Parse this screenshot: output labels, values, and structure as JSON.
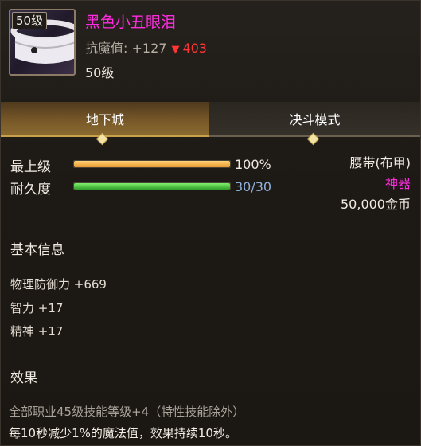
{
  "item": {
    "level_badge": "50级",
    "name": "黑色小丑眼泪",
    "stat_label": "抗魔值: +127",
    "stat_arrow": "▼",
    "stat_delta": "403",
    "required_level": "50级",
    "colors": {
      "name": "#ff2ce0",
      "decrease": "#ff3535"
    }
  },
  "tabs": [
    {
      "label": "地下城",
      "active": true
    },
    {
      "label": "决斗模式",
      "active": false
    }
  ],
  "bars": {
    "grade": {
      "label": "最上级",
      "value": "100%",
      "fill_fraction": 1.0,
      "color": "#e8992d"
    },
    "durability": {
      "label": "耐久度",
      "value": "30/30",
      "fill_fraction": 1.0,
      "color": "#2f9d2a",
      "value_color": "#8fb0d8"
    }
  },
  "info": {
    "type": "腰带(布甲)",
    "rarity": "神器",
    "rarity_color": "#ff2ce0",
    "price": "50,000金币"
  },
  "basic": {
    "title": "基本信息",
    "attributes": [
      "物理防御力 +669",
      "智力 +17",
      "精神 +17"
    ]
  },
  "effects": {
    "title": "效果",
    "lines": [
      "全部职业45级技能等级+4（特性技能除外）",
      "每10秒减少1%的魔法值，效果持续10秒。"
    ]
  }
}
